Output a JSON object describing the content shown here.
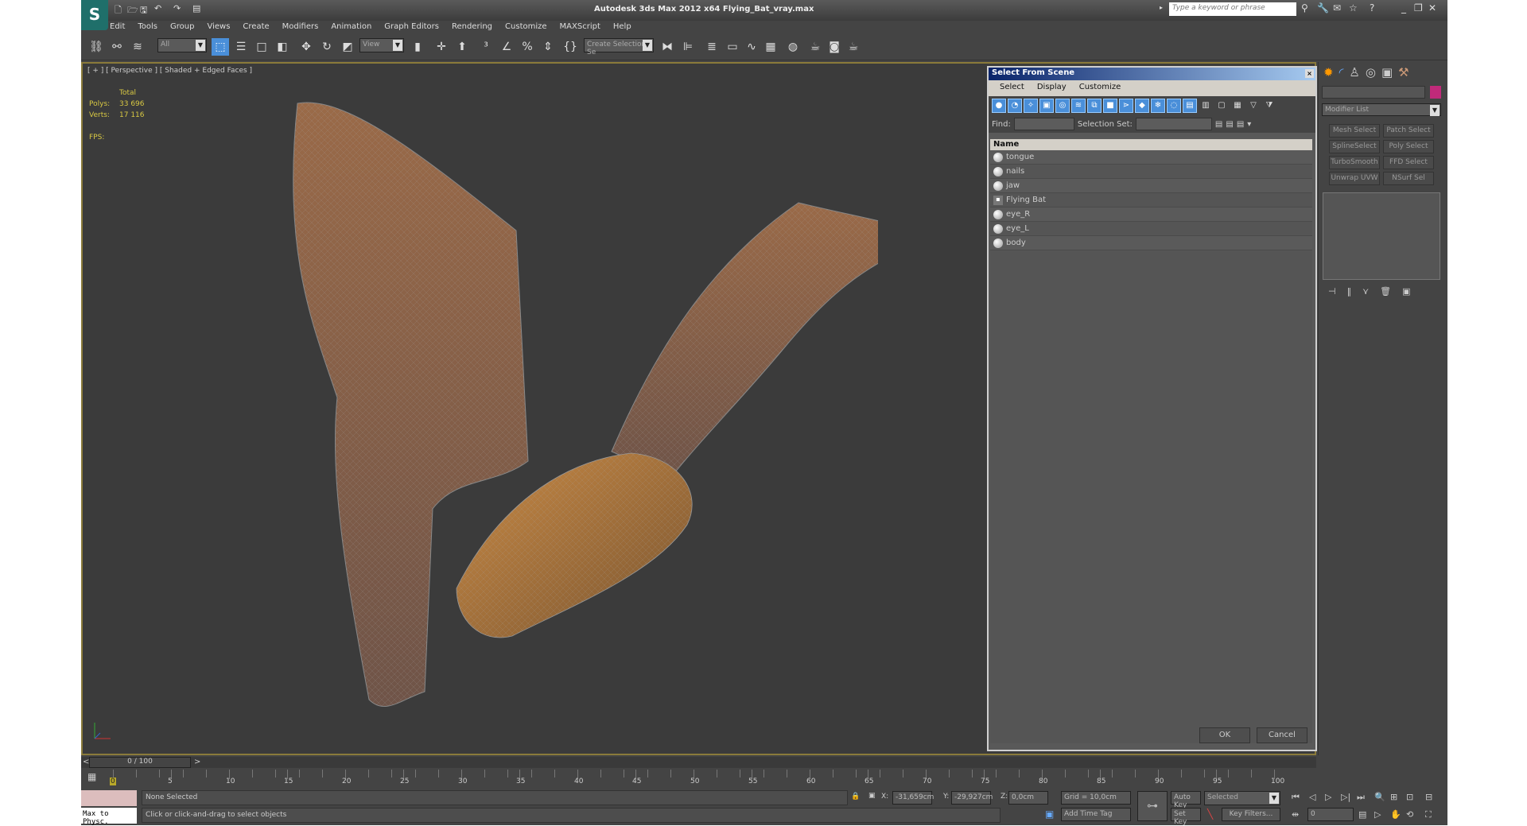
{
  "app": {
    "title": "Autodesk 3ds Max  2012 x64     Flying_Bat_vray.max",
    "logo": "S",
    "search_placeholder": "Type a keyword or phrase"
  },
  "menu": [
    "Edit",
    "Tools",
    "Group",
    "Views",
    "Create",
    "Modifiers",
    "Animation",
    "Graph Editors",
    "Rendering",
    "Customize",
    "MAXScript",
    "Help"
  ],
  "toolbar": {
    "filter": "All",
    "ref_coord": "View",
    "selection_set": "Create Selection Se"
  },
  "viewport": {
    "label": "[ + ] [ Perspective ] [ Shaded + Edged Faces ]",
    "stats": {
      "total": "Total",
      "polys_label": "Polys:",
      "polys": "33 696",
      "verts_label": "Verts:",
      "verts": "17 116",
      "fps_label": "FPS:"
    }
  },
  "dialog": {
    "title": "Select From Scene",
    "menu": [
      "Select",
      "Display",
      "Customize"
    ],
    "find_label": "Find:",
    "selset_label": "Selection Set:",
    "column": "Name",
    "items": [
      {
        "name": "tongue",
        "type": "geometry"
      },
      {
        "name": "nails",
        "type": "geometry"
      },
      {
        "name": "jaw",
        "type": "geometry"
      },
      {
        "name": "Flying Bat",
        "type": "group"
      },
      {
        "name": "eye_R",
        "type": "geometry"
      },
      {
        "name": "eye_L",
        "type": "geometry"
      },
      {
        "name": "body",
        "type": "geometry"
      }
    ],
    "ok": "OK",
    "cancel": "Cancel"
  },
  "command_panel": {
    "modifier_list": "Modifier List",
    "object_color": "#c02a7a",
    "buttons": [
      "Mesh Select",
      "Patch Select",
      "SplineSelect",
      "Poly Select",
      "TurboSmooth",
      "FFD Select",
      "Unwrap UVW",
      "NSurf Sel"
    ]
  },
  "timeline": {
    "slider": "0 / 100",
    "ticks": [
      "0",
      "5",
      "10",
      "15",
      "20",
      "25",
      "30",
      "35",
      "40",
      "45",
      "50",
      "55",
      "60",
      "65",
      "70",
      "75",
      "80",
      "85",
      "90",
      "95",
      "100"
    ]
  },
  "status": {
    "maxscript": "Max to Physc.",
    "selection": "None Selected",
    "prompt": "Click or click-and-drag to select objects",
    "x_label": "X:",
    "x": "-31,659cm",
    "y_label": "Y:",
    "y": "-29,927cm",
    "z_label": "Z:",
    "z": "0,0cm",
    "grid": "Grid = 10,0cm",
    "add_time_tag": "Add Time Tag",
    "auto_key": "Auto Key",
    "key_mode": "Selected",
    "set_key": "Set Key",
    "key_filters": "Key Filters...",
    "frame": "0"
  }
}
